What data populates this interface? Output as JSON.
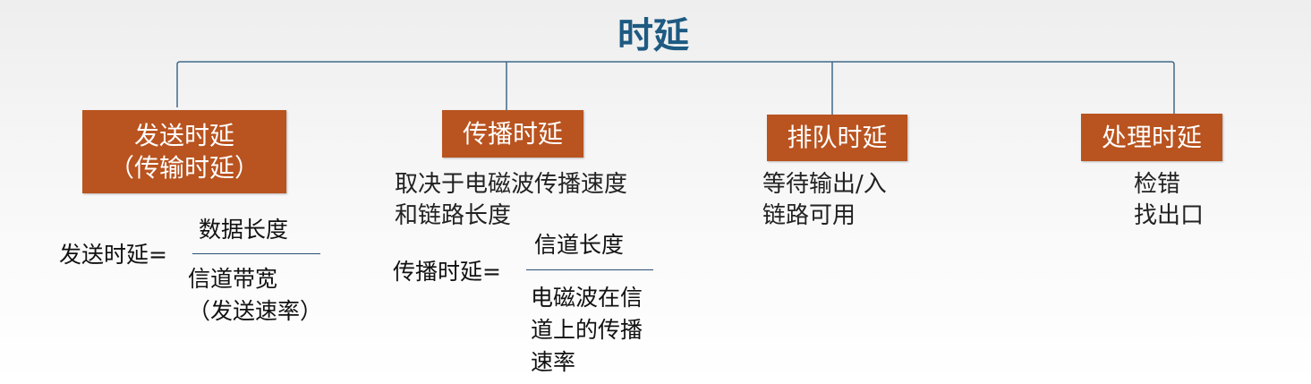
{
  "title": "时延",
  "branches": [
    {
      "box_lines": [
        "发送时延",
        "（传输时延）"
      ],
      "description": [],
      "formula": {
        "label": "发送时延=",
        "numerator": [
          "数据长度"
        ],
        "denominator": [
          "信道带宽",
          "（发送速率）"
        ]
      }
    },
    {
      "box_lines": [
        "传播时延"
      ],
      "description": [
        "取决于电磁波传播速度",
        "和链路长度"
      ],
      "formula": {
        "label": "传播时延=",
        "numerator": [
          "信道长度"
        ],
        "denominator": [
          "电磁波在信",
          "道上的传播",
          "速率"
        ]
      }
    },
    {
      "box_lines": [
        "排队时延"
      ],
      "description": [
        "等待输出/入",
        "链路可用"
      ]
    },
    {
      "box_lines": [
        "处理时延"
      ],
      "description": [
        "检错",
        "找出口"
      ]
    }
  ],
  "colors": {
    "title": "#1e5a82",
    "box_fill": "#b9531f",
    "box_text": "#ffffff",
    "connector": "#3f6a8a"
  }
}
